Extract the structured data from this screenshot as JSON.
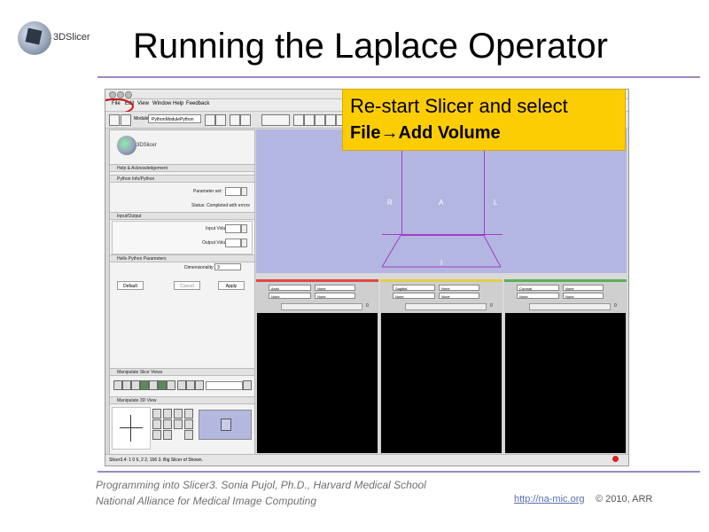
{
  "slide": {
    "title": "Running the Laplace Operator",
    "logo_text": "3DSlicer",
    "footer_line1": "Programming into Slicer3. Sonia Pujol, Ph.D., Harvard Medical School",
    "footer_line2": "National Alliance for Medical Image Computing",
    "footer_url": "http://na-mic.org",
    "footer_copyright": "© 2010, ARR",
    "accent_color": "#9a8ac0"
  },
  "callout": {
    "line1": "Re-start Slicer and select",
    "line2": "File→Add Volume",
    "color": "#fdcd04"
  },
  "app": {
    "menu": [
      "File",
      "Edit",
      "View",
      "Window",
      "Help",
      "Feedback"
    ],
    "modules_label": "Modules:",
    "modules_value": "PythonModulePython",
    "panel_logo": "3DSlicer",
    "sections": {
      "help": "Help & Acknowledgement",
      "python": "Python Info/Python",
      "inout": "Input/Output",
      "params": "Hello Python Parameters",
      "slice_views": "Manipulate Slice Views",
      "view3d": "Manipulate 3D View"
    },
    "parameter_set_label": "Parameter set:",
    "status_label": "Status: Completed with errors",
    "input_volume_label": "Input Volume",
    "output_volume_label": "Output Volume",
    "dimensionality_label": "Dimensionality",
    "dimensionality_value": "3",
    "buttons": {
      "default": "Default",
      "cancel": "Cancel",
      "apply": "Apply"
    },
    "view3d_labels": {
      "left": "R",
      "center": "A",
      "right": "L",
      "bottom": "I"
    },
    "slices": [
      {
        "name": "Axial",
        "bar_color": "#e04848",
        "fg": "None",
        "lb": "None",
        "value": "0"
      },
      {
        "name": "Sagittal",
        "bar_color": "#e0d048",
        "fg": "None",
        "lb": "None",
        "value": "0"
      },
      {
        "name": "Coronal",
        "bar_color": "#5ab05a",
        "fg": "None",
        "lb": "None",
        "value": "0"
      }
    ],
    "status_bar": "Slicer3.4: 1 0 6, 2 2, 166 3. Big Slicer of Shown."
  }
}
